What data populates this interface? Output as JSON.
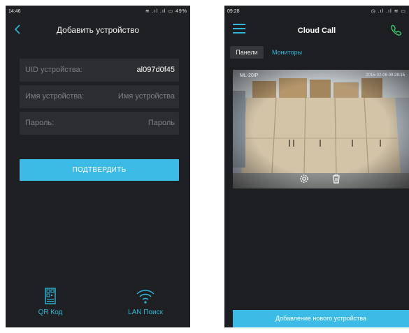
{
  "left_screen": {
    "status": {
      "time": "14:46",
      "indicators": "≋ .ıl .ıl ▭ 49%"
    },
    "nav": {
      "back_icon": "chevron-left-icon",
      "title": "Добавить устройство"
    },
    "fields": {
      "uid": {
        "label": "UID устройства:",
        "value": "al097d0f45"
      },
      "name": {
        "label": "Имя устройства:",
        "placeholder": "Имя устройства"
      },
      "password": {
        "label": "Пароль:",
        "placeholder": "Пароль"
      }
    },
    "confirm_label": "ПОДТВЕРДИТЬ",
    "bottom": {
      "qr_label": "QR Код",
      "lan_label": "LAN Поиск"
    }
  },
  "right_screen": {
    "status": {
      "time": "09:28",
      "indicators": "◷ .ıl .ıl ≋ ▭"
    },
    "header": {
      "title": "Cloud Call",
      "menu_icon": "hamburger-menu-icon",
      "call_icon": "phone-icon"
    },
    "tabs": [
      {
        "label": "Панели"
      },
      {
        "label": "Мониторы"
      }
    ],
    "camera": {
      "label": "ML-20IP",
      "timestamp": "2015-02-06 09:28:15"
    },
    "add_device_label": "Добавление нового устройства"
  },
  "colors": {
    "accent": "#3bbbe6",
    "background": "#1f2023",
    "field_bg": "#2c2d31",
    "muted_text": "#7c7f86"
  }
}
